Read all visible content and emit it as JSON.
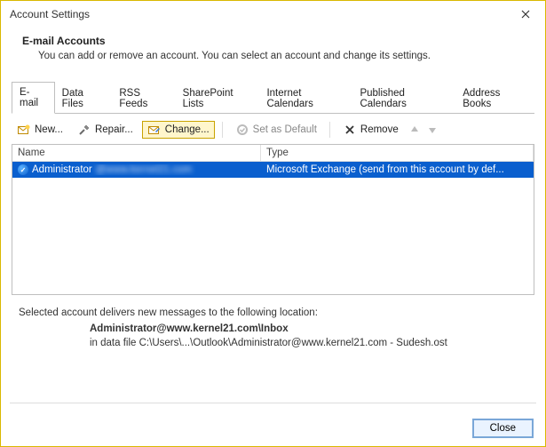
{
  "window": {
    "title": "Account Settings"
  },
  "header": {
    "heading": "E-mail Accounts",
    "subtext": "You can add or remove an account. You can select an account and change its settings."
  },
  "tabs": [
    {
      "label": "E-mail"
    },
    {
      "label": "Data Files"
    },
    {
      "label": "RSS Feeds"
    },
    {
      "label": "SharePoint Lists"
    },
    {
      "label": "Internet Calendars"
    },
    {
      "label": "Published Calendars"
    },
    {
      "label": "Address Books"
    }
  ],
  "toolbar": {
    "new": "New...",
    "repair": "Repair...",
    "change": "Change...",
    "set_default": "Set as Default",
    "remove": "Remove"
  },
  "table": {
    "headers": {
      "name": "Name",
      "type": "Type"
    },
    "rows": [
      {
        "name_visible": "Administrator",
        "name_hidden": "@www.kernel21.com",
        "type": "Microsoft Exchange (send from this account by def..."
      }
    ]
  },
  "info": {
    "text": "Selected account delivers new messages to the following location:",
    "bold": "Administrator@www.kernel21.com\\Inbox",
    "path": "in data file C:\\Users\\...\\Outlook\\Administrator@www.kernel21.com - Sudesh.ost"
  },
  "buttons": {
    "close": "Close"
  }
}
